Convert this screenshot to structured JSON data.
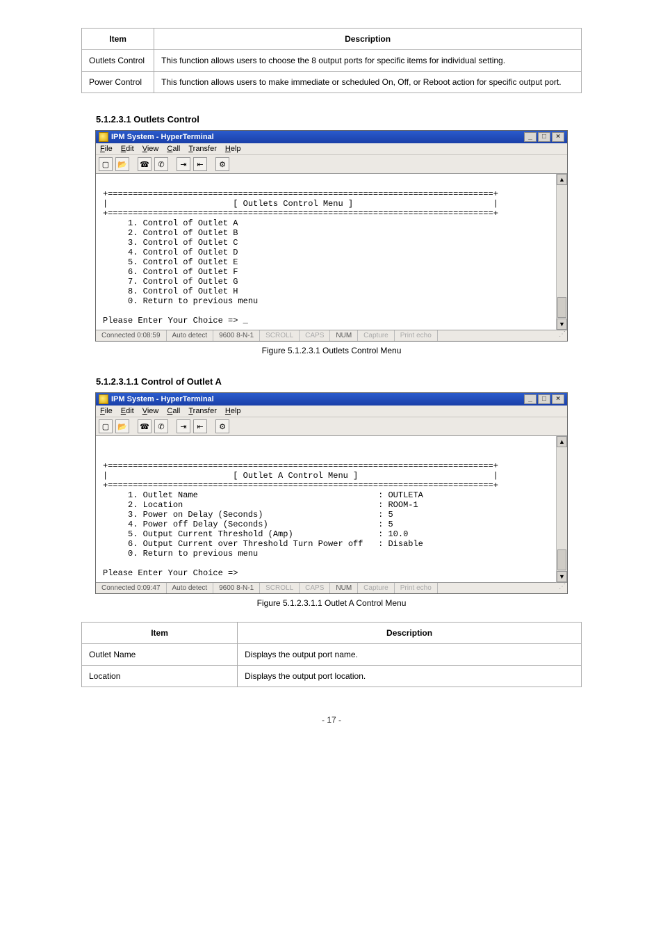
{
  "table1": {
    "headers": [
      "Item",
      "Description"
    ],
    "rows": [
      [
        "Outlets Control",
        "This function allows users to choose the 8 output ports for specific items for individual setting."
      ],
      [
        "Power Control",
        "This function allows users to make immediate or scheduled On, Off, or Reboot action for specific output port."
      ]
    ]
  },
  "section1": "5.1.2.3.1 Outlets Control",
  "caption1": "Figure 5.1.2.3.1 Outlets Control Menu",
  "section2": "5.1.2.3.1.1 Control of Outlet A",
  "caption2": "Figure 5.1.2.3.1.1 Outlet A Control Menu",
  "ht": {
    "title": "IPM System - HyperTerminal",
    "menus": [
      {
        "u": "F",
        "rest": "ile"
      },
      {
        "u": "E",
        "rest": "dit"
      },
      {
        "u": "V",
        "rest": "iew"
      },
      {
        "u": "C",
        "rest": "all"
      },
      {
        "u": "T",
        "rest": "ransfer"
      },
      {
        "u": "H",
        "rest": "elp"
      }
    ],
    "status_cells": [
      "Auto detect",
      "9600 8-N-1",
      "SCROLL",
      "CAPS",
      "NUM",
      "Capture",
      "Print echo"
    ]
  },
  "term1": {
    "connected": "Connected 0:08:59",
    "lines": "\n+=============================================================================+\n|                         [ Outlets Control Menu ]                            |\n+=============================================================================+\n     1. Control of Outlet A\n     2. Control of Outlet B\n     3. Control of Outlet C\n     4. Control of Outlet D\n     5. Control of Outlet E\n     6. Control of Outlet F\n     7. Control of Outlet G\n     8. Control of Outlet H\n     0. Return to previous menu\n\nPlease Enter Your Choice => _\n"
  },
  "term2": {
    "connected": "Connected 0:09:47",
    "lines": "\n\n+=============================================================================+\n|                         [ Outlet A Control Menu ]                           |\n+=============================================================================+\n     1. Outlet Name                                    : OUTLETA\n     2. Location                                       : ROOM-1\n     3. Power on Delay (Seconds)                       : 5\n     4. Power off Delay (Seconds)                      : 5\n     5. Output Current Threshold (Amp)                 : 10.0\n     6. Output Current over Threshold Turn Power off   : Disable\n     0. Return to previous menu\n\nPlease Enter Your Choice =>\n"
  },
  "table2": {
    "headers": [
      "Item",
      "Description"
    ],
    "rows": [
      [
        "Outlet Name",
        "Displays the output port name."
      ],
      [
        "Location",
        "Displays the output port location."
      ]
    ]
  },
  "footer": "- 17 -"
}
